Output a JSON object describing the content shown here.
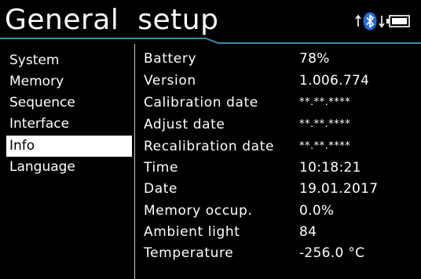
{
  "header": {
    "title": "General  setup",
    "icons": [
      "arrow-up-icon",
      "bluetooth-icon",
      "arrow-down-icon",
      "battery-icon"
    ]
  },
  "sidebar": {
    "items": [
      {
        "label": "System",
        "active": false
      },
      {
        "label": "Memory",
        "active": false
      },
      {
        "label": "Sequence",
        "active": false
      },
      {
        "label": "Interface",
        "active": false
      },
      {
        "label": "Info",
        "active": true
      },
      {
        "label": "Language",
        "active": false
      }
    ]
  },
  "info": {
    "rows": [
      {
        "label": "Battery",
        "value": "78%"
      },
      {
        "label": "Version",
        "value": "1.006.774"
      },
      {
        "label": "Calibration date",
        "value": "**.**.****"
      },
      {
        "label": "Adjust date",
        "value": "**.**.****"
      },
      {
        "label": "Recalibration date",
        "value": "**.**.****"
      },
      {
        "label": "Time",
        "value": "10:18:21"
      },
      {
        "label": "Date",
        "value": "19.01.2017"
      },
      {
        "label": "Memory occup.",
        "value": "0.0%"
      },
      {
        "label": "Ambient light",
        "value": "84"
      },
      {
        "label": "Temperature",
        "value": "-256.0 °C"
      }
    ]
  },
  "colors": {
    "background": "#000000",
    "text": "#ffffff",
    "header_line": "#3a8ca6",
    "bluetooth": "#1e6fd9",
    "active_bg": "#ffffff",
    "active_text": "#000000"
  }
}
